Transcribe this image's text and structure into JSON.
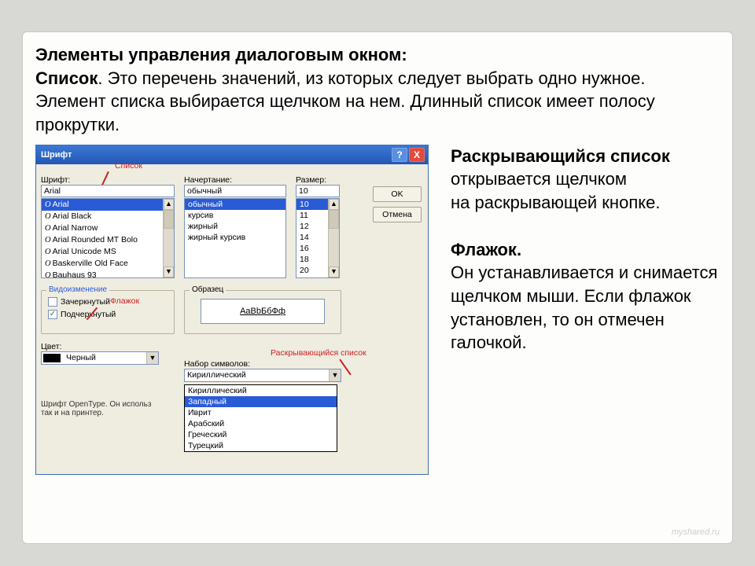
{
  "headline": {
    "title": "Элементы управления диалоговым окном:",
    "bold_lead": "Список",
    "rest": ". Это перечень значений, из которых следует выбрать одно нужное. Элемент списка выбирается щелчком на нем. Длинный список имеет полосу прокрутки."
  },
  "sidetext": {
    "p1_bold": "Раскрывающийся список",
    "p1_rest": " открывается щелчком",
    "p1_line2": " на раскрывающей кнопке.",
    "p2_bold": "Флажок.",
    "p2_rest": "Он устанавливается и снимается щелчком мыши. Если флажок установлен, то он отмечен галочкой."
  },
  "dialog": {
    "title": "Шрифт",
    "help": "?",
    "close": "X",
    "labels": {
      "font": "Шрифт:",
      "style": "Начертание:",
      "size": "Размер:",
      "effects": "Видоизменение",
      "sample": "Образец",
      "color": "Цвет:",
      "charset": "Набор символов:"
    },
    "values": {
      "font_input": "Arial",
      "style_input": "обычный",
      "size_input": "10",
      "color_value": "Черный",
      "charset_value": "Кириллический"
    },
    "font_list": [
      "Arial",
      "Arial Black",
      "Arial Narrow",
      "Arial Rounded MT Bolo",
      "Arial Unicode MS",
      "Baskerville Old Face",
      "Bauhaus 93"
    ],
    "style_list": [
      "обычный",
      "курсив",
      "жирный",
      "жирный курсив"
    ],
    "size_list": [
      "10",
      "11",
      "12",
      "14",
      "16",
      "18",
      "20"
    ],
    "checks": {
      "strike": "Зачеркнутый",
      "underline": "Подчеркнутый"
    },
    "sample_text": "AaBbБбФф",
    "dropdown": [
      "Кириллический",
      "Западный",
      "Иврит",
      "Арабский",
      "Греческий",
      "Турецкий"
    ],
    "buttons": {
      "ok": "OK",
      "cancel": "Отмена"
    },
    "hint": "Шрифт OpenType. Он использ\nтак и на принтер."
  },
  "annotations": {
    "list": "Список",
    "flag": "Флажок",
    "drop": "Раскрывающийся список"
  },
  "watermark": "myshared.ru"
}
